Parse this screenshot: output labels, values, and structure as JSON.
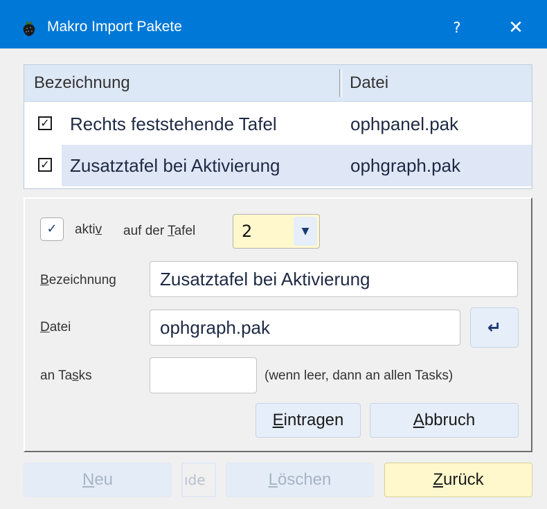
{
  "window": {
    "title": "Makro Import Pakete",
    "help_label": "?",
    "close_label": "✕"
  },
  "list": {
    "columns": [
      "Bezeichnung",
      "Datei"
    ],
    "rows": [
      {
        "checked": true,
        "name": "Rechts feststehende Tafel",
        "file": "ophpanel.pak"
      },
      {
        "checked": true,
        "name": "Zusatztafel bei Aktivierung",
        "file": "ophgraph.pak",
        "selected": true
      }
    ]
  },
  "editor": {
    "aktiv_label": "aktiv",
    "aktiv_mnemonic": "v",
    "aktiv_checked": true,
    "tafel_label": "auf der Tafel",
    "tafel_value": "2",
    "bezeichnung_label": "Bezeichnung",
    "bezeichnung_value": "Zusatztafel bei Aktivierung",
    "datei_label": "Datei",
    "datei_value": "ophgraph.pak",
    "tasks_label": "an Tasks",
    "tasks_value": "",
    "tasks_hint": "(wenn leer, dann an allen Tasks)",
    "eintragen_label": "Eintragen",
    "abbruch_label": "Abbruch"
  },
  "footer": {
    "neu_label": "Neu",
    "mini_text": "ıde",
    "loeschen_label": "Löschen",
    "zurueck_label": "Zurück"
  },
  "colors": {
    "titlebar": "#0078d7",
    "selected_row": "#dfe7f7",
    "accent_yellow": "#fff8cc",
    "button_blue": "#e6eefa"
  },
  "icons": {
    "app": "strawberry-icon",
    "enter": "return-arrow-icon",
    "dropdown": "chevron-down-icon"
  }
}
